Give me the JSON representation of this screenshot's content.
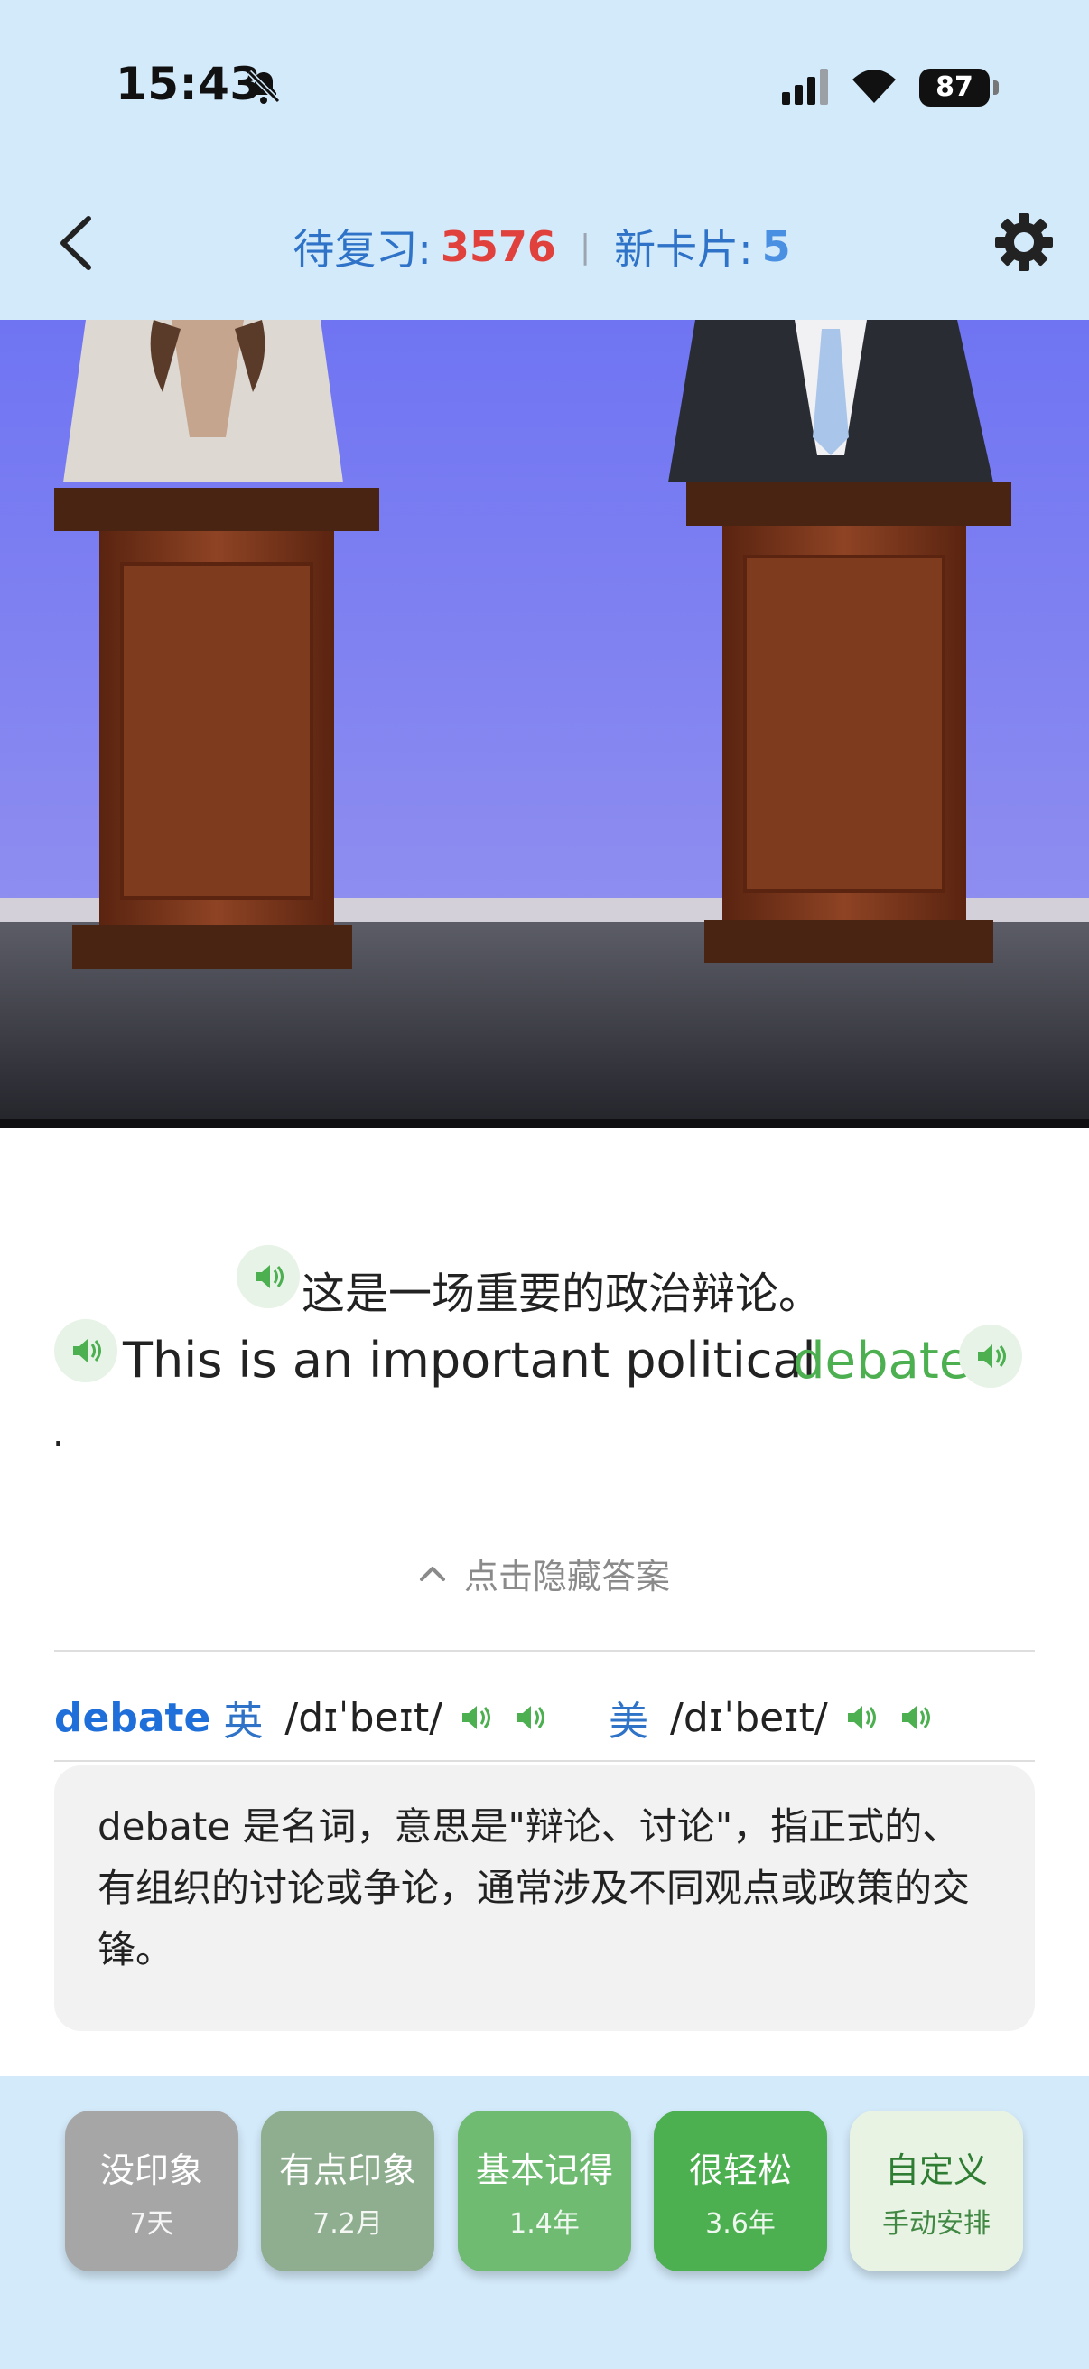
{
  "status": {
    "time": "15:43",
    "battery": "87"
  },
  "header": {
    "review_label": "待复习:",
    "review_count": "3576",
    "separator": "|",
    "new_label": "新卡片:",
    "new_count": "5"
  },
  "card": {
    "sentence_zh": "这是一场重要的政治辩论。",
    "sentence_en": "This is an important political",
    "target_word": "debate",
    "trailing_punct": "."
  },
  "toggle": {
    "label": "点击隐藏答案"
  },
  "phonetics": {
    "word": "debate",
    "uk_label": "英",
    "uk_ipa": "/dɪˈbeɪt/",
    "us_label": "美",
    "us_ipa": "/dɪˈbeɪt/"
  },
  "explanation": "debate 是名词，意思是\"辩论、讨论\"，指正式的、有组织的讨论或争论，通常涉及不同观点或政策的交锋。",
  "ratings": [
    {
      "title": "没印象",
      "sub": "7天",
      "color": "#a6a6a6"
    },
    {
      "title": "有点印象",
      "sub": "7.2月",
      "color": "#8fae90"
    },
    {
      "title": "基本记得",
      "sub": "1.4年",
      "color": "#6fbb72"
    },
    {
      "title": "很轻松",
      "sub": "3.6年",
      "color": "#4caf50"
    },
    {
      "title": "自定义",
      "sub": "手动安排",
      "color": "#e8f3e4"
    }
  ],
  "colors": {
    "topbar": "#d3eafa",
    "accent_green": "#4caf50",
    "red": "#e0413d",
    "blue": "#2e73c8"
  }
}
